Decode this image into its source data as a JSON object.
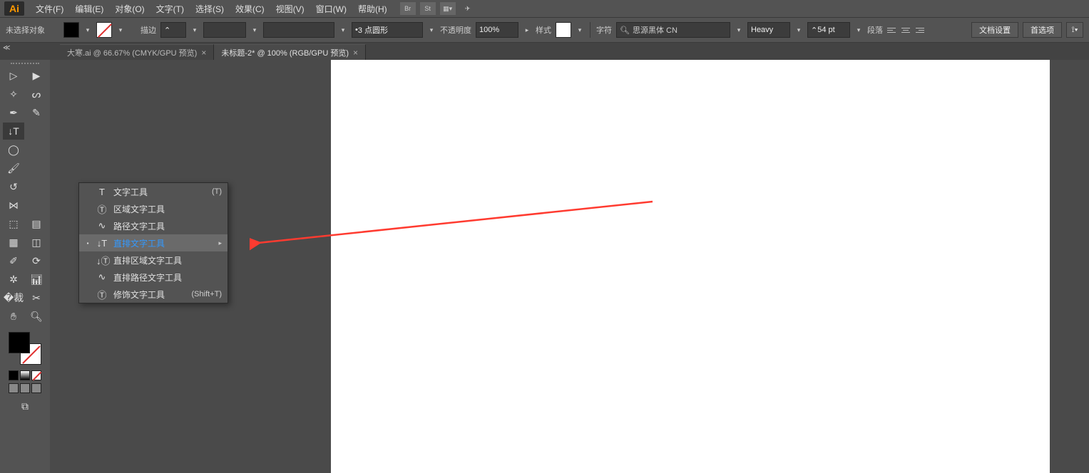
{
  "menu": {
    "items": [
      "文件(F)",
      "编辑(E)",
      "对象(O)",
      "文字(T)",
      "选择(S)",
      "效果(C)",
      "视图(V)",
      "窗口(W)",
      "帮助(H)"
    ],
    "right_icons": [
      "Br",
      "St"
    ]
  },
  "options": {
    "selection_status": "未选择对象",
    "stroke_label": "描边",
    "stroke_dash": "",
    "brush_dropdown": "",
    "brush_profile_value": "3 点圆形",
    "opacity_label": "不透明度",
    "opacity_value": "100%",
    "style_label": "样式",
    "char_label": "字符",
    "font_name": "思源黑体 CN",
    "font_weight": "Heavy",
    "font_size": "54 pt",
    "para_label": "段落",
    "doc_setup": "文档设置",
    "prefs": "首选项"
  },
  "tabs": [
    {
      "label": "大寒.ai @ 66.67% (CMYK/GPU 预览)",
      "active": false
    },
    {
      "label": "未标题-2* @ 100% (RGB/GPU 预览)",
      "active": true
    }
  ],
  "flyout": {
    "items": [
      {
        "label": "文字工具",
        "shortcut": "(T)",
        "bullet": false,
        "hover": false
      },
      {
        "label": "区域文字工具",
        "shortcut": "",
        "bullet": false,
        "hover": false
      },
      {
        "label": "路径文字工具",
        "shortcut": "",
        "bullet": false,
        "hover": false
      },
      {
        "label": "直排文字工具",
        "shortcut": "",
        "bullet": true,
        "hover": true,
        "submenu": true
      },
      {
        "label": "直排区域文字工具",
        "shortcut": "",
        "bullet": false,
        "hover": false
      },
      {
        "label": "直排路径文字工具",
        "shortcut": "",
        "bullet": false,
        "hover": false
      },
      {
        "label": "修饰文字工具",
        "shortcut": "(Shift+T)",
        "bullet": false,
        "hover": false
      }
    ]
  }
}
